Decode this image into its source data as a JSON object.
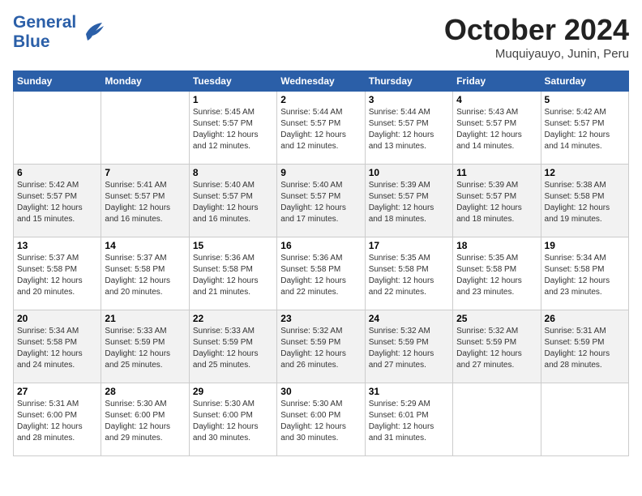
{
  "header": {
    "logo_line1": "General",
    "logo_line2": "Blue",
    "month": "October 2024",
    "location": "Muquiyauyo, Junin, Peru"
  },
  "days_of_week": [
    "Sunday",
    "Monday",
    "Tuesday",
    "Wednesday",
    "Thursday",
    "Friday",
    "Saturday"
  ],
  "weeks": [
    [
      {
        "day": "",
        "info": ""
      },
      {
        "day": "",
        "info": ""
      },
      {
        "day": "1",
        "info": "Sunrise: 5:45 AM\nSunset: 5:57 PM\nDaylight: 12 hours\nand 12 minutes."
      },
      {
        "day": "2",
        "info": "Sunrise: 5:44 AM\nSunset: 5:57 PM\nDaylight: 12 hours\nand 12 minutes."
      },
      {
        "day": "3",
        "info": "Sunrise: 5:44 AM\nSunset: 5:57 PM\nDaylight: 12 hours\nand 13 minutes."
      },
      {
        "day": "4",
        "info": "Sunrise: 5:43 AM\nSunset: 5:57 PM\nDaylight: 12 hours\nand 14 minutes."
      },
      {
        "day": "5",
        "info": "Sunrise: 5:42 AM\nSunset: 5:57 PM\nDaylight: 12 hours\nand 14 minutes."
      }
    ],
    [
      {
        "day": "6",
        "info": "Sunrise: 5:42 AM\nSunset: 5:57 PM\nDaylight: 12 hours\nand 15 minutes."
      },
      {
        "day": "7",
        "info": "Sunrise: 5:41 AM\nSunset: 5:57 PM\nDaylight: 12 hours\nand 16 minutes."
      },
      {
        "day": "8",
        "info": "Sunrise: 5:40 AM\nSunset: 5:57 PM\nDaylight: 12 hours\nand 16 minutes."
      },
      {
        "day": "9",
        "info": "Sunrise: 5:40 AM\nSunset: 5:57 PM\nDaylight: 12 hours\nand 17 minutes."
      },
      {
        "day": "10",
        "info": "Sunrise: 5:39 AM\nSunset: 5:57 PM\nDaylight: 12 hours\nand 18 minutes."
      },
      {
        "day": "11",
        "info": "Sunrise: 5:39 AM\nSunset: 5:57 PM\nDaylight: 12 hours\nand 18 minutes."
      },
      {
        "day": "12",
        "info": "Sunrise: 5:38 AM\nSunset: 5:58 PM\nDaylight: 12 hours\nand 19 minutes."
      }
    ],
    [
      {
        "day": "13",
        "info": "Sunrise: 5:37 AM\nSunset: 5:58 PM\nDaylight: 12 hours\nand 20 minutes."
      },
      {
        "day": "14",
        "info": "Sunrise: 5:37 AM\nSunset: 5:58 PM\nDaylight: 12 hours\nand 20 minutes."
      },
      {
        "day": "15",
        "info": "Sunrise: 5:36 AM\nSunset: 5:58 PM\nDaylight: 12 hours\nand 21 minutes."
      },
      {
        "day": "16",
        "info": "Sunrise: 5:36 AM\nSunset: 5:58 PM\nDaylight: 12 hours\nand 22 minutes."
      },
      {
        "day": "17",
        "info": "Sunrise: 5:35 AM\nSunset: 5:58 PM\nDaylight: 12 hours\nand 22 minutes."
      },
      {
        "day": "18",
        "info": "Sunrise: 5:35 AM\nSunset: 5:58 PM\nDaylight: 12 hours\nand 23 minutes."
      },
      {
        "day": "19",
        "info": "Sunrise: 5:34 AM\nSunset: 5:58 PM\nDaylight: 12 hours\nand 23 minutes."
      }
    ],
    [
      {
        "day": "20",
        "info": "Sunrise: 5:34 AM\nSunset: 5:58 PM\nDaylight: 12 hours\nand 24 minutes."
      },
      {
        "day": "21",
        "info": "Sunrise: 5:33 AM\nSunset: 5:59 PM\nDaylight: 12 hours\nand 25 minutes."
      },
      {
        "day": "22",
        "info": "Sunrise: 5:33 AM\nSunset: 5:59 PM\nDaylight: 12 hours\nand 25 minutes."
      },
      {
        "day": "23",
        "info": "Sunrise: 5:32 AM\nSunset: 5:59 PM\nDaylight: 12 hours\nand 26 minutes."
      },
      {
        "day": "24",
        "info": "Sunrise: 5:32 AM\nSunset: 5:59 PM\nDaylight: 12 hours\nand 27 minutes."
      },
      {
        "day": "25",
        "info": "Sunrise: 5:32 AM\nSunset: 5:59 PM\nDaylight: 12 hours\nand 27 minutes."
      },
      {
        "day": "26",
        "info": "Sunrise: 5:31 AM\nSunset: 5:59 PM\nDaylight: 12 hours\nand 28 minutes."
      }
    ],
    [
      {
        "day": "27",
        "info": "Sunrise: 5:31 AM\nSunset: 6:00 PM\nDaylight: 12 hours\nand 28 minutes."
      },
      {
        "day": "28",
        "info": "Sunrise: 5:30 AM\nSunset: 6:00 PM\nDaylight: 12 hours\nand 29 minutes."
      },
      {
        "day": "29",
        "info": "Sunrise: 5:30 AM\nSunset: 6:00 PM\nDaylight: 12 hours\nand 30 minutes."
      },
      {
        "day": "30",
        "info": "Sunrise: 5:30 AM\nSunset: 6:00 PM\nDaylight: 12 hours\nand 30 minutes."
      },
      {
        "day": "31",
        "info": "Sunrise: 5:29 AM\nSunset: 6:01 PM\nDaylight: 12 hours\nand 31 minutes."
      },
      {
        "day": "",
        "info": ""
      },
      {
        "day": "",
        "info": ""
      }
    ]
  ]
}
